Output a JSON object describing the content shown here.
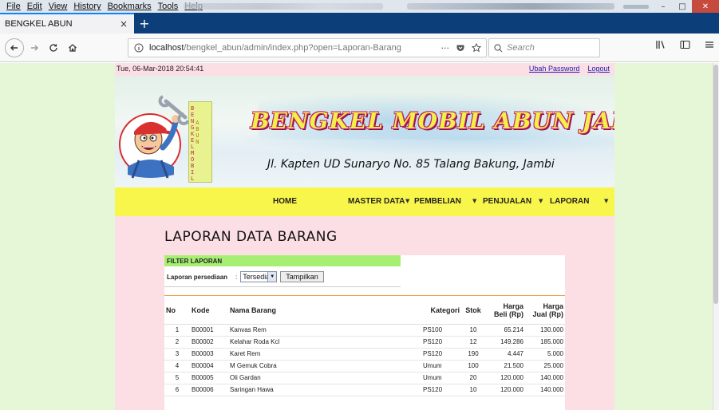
{
  "menubar": {
    "items": [
      "File",
      "Edit",
      "View",
      "History",
      "Bookmarks",
      "Tools",
      "Help"
    ]
  },
  "window_controls": {
    "minimize": "–",
    "maximize": "□",
    "close": "✕"
  },
  "tab": {
    "title": "BENGKEL ABUN",
    "close_symbol": "×",
    "newtab_symbol": "+"
  },
  "nav": {
    "url_host": "localhost",
    "url_path": "/bengkel_abun/admin/index.php?open=Laporan-Barang",
    "search_placeholder": "Search",
    "more_symbol": "···"
  },
  "page": {
    "datetime": "Tue, 06-Mar-2018 20:54:41",
    "links": {
      "change_password": "Ubah Password",
      "logout": "Logout"
    },
    "banner": {
      "title": "BENGKEL MOBIL ABUN JAMBI",
      "address": "Jl. Kapten UD Sunaryo No. 85 Talang Bakung, Jambi",
      "sign_col1": [
        "B",
        "E",
        "N",
        "G",
        "K",
        "E",
        "L",
        "M",
        "O",
        "B",
        "I",
        "L"
      ],
      "sign_col2": [
        "A",
        "B",
        "U",
        "N"
      ]
    },
    "menu": {
      "home": "HOME",
      "master": "MASTER DATA",
      "purchase": "PEMBELIAN",
      "sales": "PENJUALAN",
      "report": "LAPORAN"
    },
    "heading": "LAPORAN DATA BARANG",
    "filter": {
      "title": "FILTER LAPORAN",
      "label": "Laporan persediaan",
      "colon": ":",
      "selected": "Tersedia",
      "button": "Tampilkan"
    },
    "table": {
      "headers": {
        "no": "No",
        "code": "Kode",
        "name": "Nama Barang",
        "category": "Kategori",
        "stock": "Stok",
        "buy_1": "Harga",
        "buy_2": "Beli (Rp)",
        "sell_1": "Harga",
        "sell_2": "Jual (Rp)"
      },
      "rows": [
        {
          "no": "1",
          "code": "B00001",
          "name": "Kanvas Rem",
          "category": "PS100",
          "stock": "10",
          "buy": "65.214",
          "sell": "130.000"
        },
        {
          "no": "2",
          "code": "B00002",
          "name": "Kelahar Roda Kcl",
          "category": "PS120",
          "stock": "12",
          "buy": "149.286",
          "sell": "185.000"
        },
        {
          "no": "3",
          "code": "B00003",
          "name": "Karet Rem",
          "category": "PS120",
          "stock": "190",
          "buy": "4.447",
          "sell": "5.000"
        },
        {
          "no": "4",
          "code": "B00004",
          "name": "M Gemuk Cobra",
          "category": "Umum",
          "stock": "100",
          "buy": "21.500",
          "sell": "25.000"
        },
        {
          "no": "5",
          "code": "B00005",
          "name": "Oli Gardan",
          "category": "Umum",
          "stock": "20",
          "buy": "120.000",
          "sell": "140.000"
        },
        {
          "no": "6",
          "code": "B00006",
          "name": "Saringan Hawa",
          "category": "PS120",
          "stock": "10",
          "buy": "120.000",
          "sell": "140.000"
        }
      ]
    }
  }
}
